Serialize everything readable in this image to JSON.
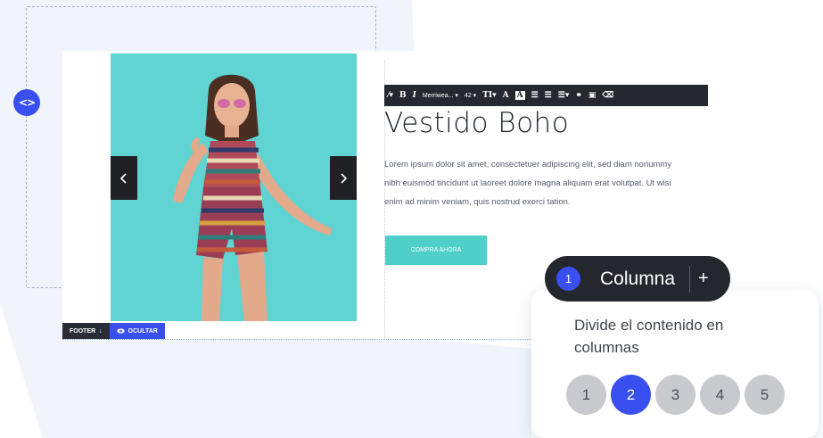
{
  "colors": {
    "accent": "#3a4ff0",
    "teal_button": "#4ecfc9",
    "dark_toolbar": "#25282f",
    "background_shape": "#f1f4fb"
  },
  "editor": {
    "nav_icon": "code-brackets-icon",
    "nav_label": "<>",
    "slider": {
      "prev_icon": "chevron-left-icon",
      "next_icon": "chevron-right-icon"
    },
    "footer_tag": {
      "label": "FOOTER",
      "arrow": "↓",
      "hide_icon": "eye-icon",
      "hide_label": "OCULTAR"
    }
  },
  "toolbar": {
    "items": [
      {
        "icon": "paint-icon",
        "label": "⁄▾"
      },
      {
        "icon": "bold-icon",
        "label": "B"
      },
      {
        "icon": "italic-icon",
        "label": "I"
      },
      {
        "icon": "font-family-select",
        "label": "Merriwea... ▾"
      },
      {
        "icon": "font-size-select",
        "label": "42 ▾"
      },
      {
        "icon": "text-style-icon",
        "label": "TI▾"
      },
      {
        "icon": "text-color-icon",
        "label": "A"
      },
      {
        "icon": "highlight-icon",
        "label": "A"
      },
      {
        "icon": "bullet-list-icon",
        "label": "☰"
      },
      {
        "icon": "numbered-list-icon",
        "label": "☰"
      },
      {
        "icon": "align-icon",
        "label": "☰▾"
      },
      {
        "icon": "link-icon",
        "label": "⚭"
      },
      {
        "icon": "image-icon",
        "label": "▣"
      },
      {
        "icon": "eraser-icon",
        "label": "⌫"
      }
    ]
  },
  "content": {
    "title": "Vestido Boho",
    "paragraph": "Lorem ipsum dolor sit amet, consectetuer adipiscing elit, sed diam nonummy nibh euismod tincidunt ut laoreet dolore magna aliquam erat volutpat. Ut wisi enim ad minim veniam, quis nostrud exerci tation.",
    "cta": "COMPRA AHORA"
  },
  "column_widget": {
    "badge": "1",
    "label": "Columna",
    "add": "+",
    "description": "Divide el contenido en columnas",
    "options": [
      "1",
      "2",
      "3",
      "4",
      "5"
    ],
    "selected": "2"
  }
}
